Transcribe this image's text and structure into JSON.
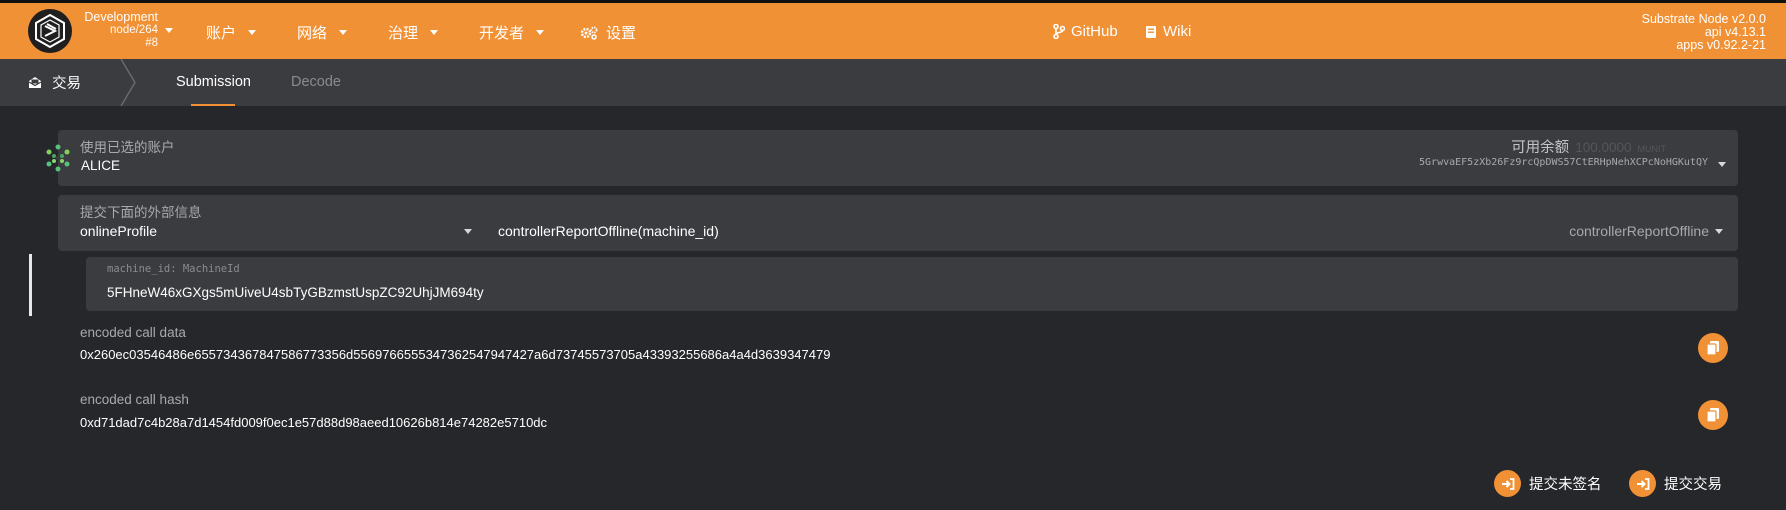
{
  "header": {
    "chain": {
      "name": "Development",
      "node": "node/264",
      "block": "#8"
    },
    "menu": [
      {
        "label": "账户"
      },
      {
        "label": "网络"
      },
      {
        "label": "治理"
      },
      {
        "label": "开发者"
      },
      {
        "label": "设置"
      }
    ],
    "links": [
      {
        "label": "GitHub"
      },
      {
        "label": "Wiki"
      }
    ],
    "versions": {
      "node": "Substrate Node v2.0.0",
      "api": "api v4.13.1",
      "apps": "apps v0.92.2-21"
    }
  },
  "subnav": {
    "title": "交易",
    "tabs": [
      {
        "label": "Submission",
        "active": true
      },
      {
        "label": "Decode",
        "active": false
      }
    ]
  },
  "account": {
    "label": "使用已选的账户",
    "name": "ALICE",
    "balance_label": "可用余额",
    "balance_value": "100.0000",
    "balance_unit": "MUNIT",
    "address": "5GrwvaEF5zXb26Fz9rcQpDWS57CtERHpNehXCPcNoHGKutQY"
  },
  "extrinsic": {
    "label": "提交下面的外部信息",
    "module": "onlineProfile",
    "method_signature": "controllerReportOffline(machine_id)",
    "method": "controllerReportOffline"
  },
  "param": {
    "label": "machine_id: MachineId",
    "value": "5FHneW46xGXgs5mUiveU4sbTyGBzmstUspZC92UhjJM694ty"
  },
  "encoded": {
    "data_label": "encoded call data",
    "data_value": "0x260ec03546486e65573436784758677335 6d5569766555347362547947427a6d73745573705a43393255686a4a4d3639347479",
    "hash_label": "encoded call hash",
    "hash_value": "0xd71dad7c4b28a7d1454fd009f0ec1e57d88d98aeed10626b814e74282e5710dc"
  },
  "actions": {
    "unsigned": "提交未签名",
    "submit": "提交交易"
  },
  "colors": {
    "accent": "#f19135",
    "background": "#26272b",
    "panel": "#3b3c40"
  }
}
